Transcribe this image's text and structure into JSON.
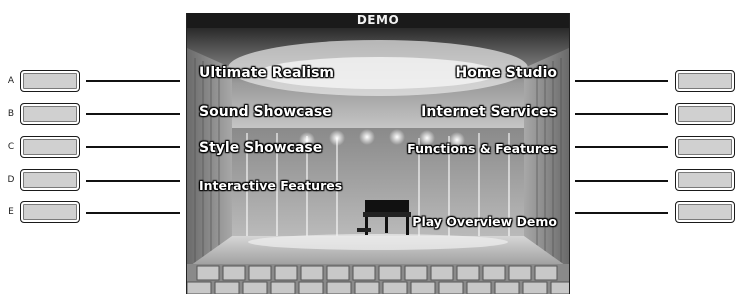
{
  "screen": {
    "title": "DEMO"
  },
  "menu": {
    "left": [
      {
        "id": "A",
        "label": "Ultimate Realism"
      },
      {
        "id": "B",
        "label": "Sound Showcase"
      },
      {
        "id": "C",
        "label": "Style Showcase"
      },
      {
        "id": "D",
        "label": "Interactive Features"
      },
      {
        "id": "E",
        "label": ""
      }
    ],
    "right": [
      {
        "label": "Home Studio"
      },
      {
        "label": "Internet Services"
      },
      {
        "label": "Functions & Features"
      },
      {
        "label": ""
      },
      {
        "label": "Play Overview Demo"
      }
    ]
  },
  "side_buttons": {
    "left_labels": [
      "A",
      "B",
      "C",
      "D",
      "E"
    ]
  },
  "colors": {
    "title_bar": "#1a1a1a",
    "button_face": "#d0d0d0",
    "menu_text": "#ffffff"
  },
  "icons": {
    "background": "concert-hall-stage-image",
    "instrument": "grand-piano-icon"
  }
}
